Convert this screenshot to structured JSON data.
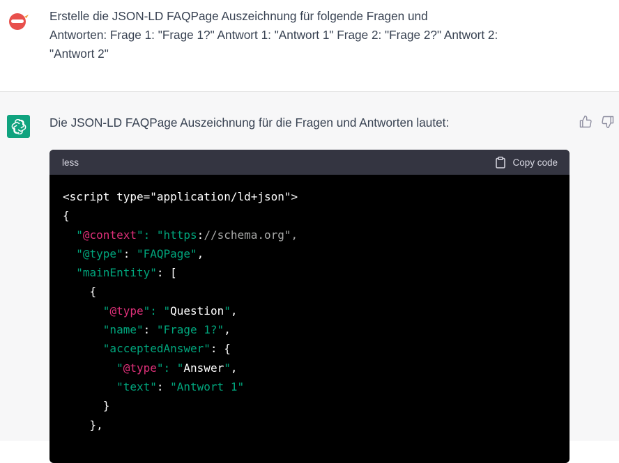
{
  "user_message": {
    "text": "Erstelle die JSON-LD FAQPage Auszeichnung für folgende Fragen und\nAntworten: Frage 1: \"Frage 1?\" Antwort 1: \"Antwort 1\" Frage 2: \"Frage 2?\" Antwort 2:\n\"Antwort 2\""
  },
  "assistant_message": {
    "intro": "Die JSON-LD FAQPage Auszeichnung für die Fragen und Antworten lautet:"
  },
  "code_block": {
    "language": "less",
    "copy_label": "Copy code",
    "lines": [
      [
        {
          "t": "plain",
          "v": "<script type=\"application/ld+json\">"
        }
      ],
      [
        {
          "t": "plain",
          "v": "{"
        }
      ],
      [
        {
          "t": "plain",
          "v": "  "
        },
        {
          "t": "str",
          "v": "\""
        },
        {
          "t": "key",
          "v": "@context"
        },
        {
          "t": "str",
          "v": "\": \"https"
        },
        {
          "t": "plain",
          "v": ":"
        },
        {
          "t": "url",
          "v": "//schema.org\","
        }
      ],
      [
        {
          "t": "plain",
          "v": "  "
        },
        {
          "t": "str",
          "v": "\"@type\""
        },
        {
          "t": "plain",
          "v": ": "
        },
        {
          "t": "str",
          "v": "\"FAQPage\""
        },
        {
          "t": "plain",
          "v": ","
        }
      ],
      [
        {
          "t": "plain",
          "v": "  "
        },
        {
          "t": "str",
          "v": "\"mainEntity\""
        },
        {
          "t": "plain",
          "v": ": ["
        }
      ],
      [
        {
          "t": "plain",
          "v": "    {"
        }
      ],
      [
        {
          "t": "plain",
          "v": "      "
        },
        {
          "t": "str",
          "v": "\""
        },
        {
          "t": "key",
          "v": "@type"
        },
        {
          "t": "str",
          "v": "\": \""
        },
        {
          "t": "plain",
          "v": "Question"
        },
        {
          "t": "str",
          "v": "\""
        },
        {
          "t": "plain",
          "v": ","
        }
      ],
      [
        {
          "t": "plain",
          "v": "      "
        },
        {
          "t": "str",
          "v": "\"name\""
        },
        {
          "t": "plain",
          "v": ": "
        },
        {
          "t": "str",
          "v": "\"Frage 1?\""
        },
        {
          "t": "plain",
          "v": ","
        }
      ],
      [
        {
          "t": "plain",
          "v": "      "
        },
        {
          "t": "str",
          "v": "\"acceptedAnswer\""
        },
        {
          "t": "plain",
          "v": ": {"
        }
      ],
      [
        {
          "t": "plain",
          "v": "        "
        },
        {
          "t": "str",
          "v": "\""
        },
        {
          "t": "key",
          "v": "@type"
        },
        {
          "t": "str",
          "v": "\": \""
        },
        {
          "t": "plain",
          "v": "Answer"
        },
        {
          "t": "str",
          "v": "\""
        },
        {
          "t": "plain",
          "v": ","
        }
      ],
      [
        {
          "t": "plain",
          "v": "        "
        },
        {
          "t": "str",
          "v": "\"text\""
        },
        {
          "t": "plain",
          "v": ": "
        },
        {
          "t": "str",
          "v": "\"Antwort 1\""
        }
      ],
      [
        {
          "t": "plain",
          "v": "      }"
        }
      ],
      [
        {
          "t": "plain",
          "v": "    },"
        }
      ]
    ]
  },
  "colors": {
    "string": "#00a67d",
    "keyword": "#df3079",
    "gpt_brand": "#10a37f",
    "code_bg": "#000000",
    "code_header_bg": "#343541"
  }
}
